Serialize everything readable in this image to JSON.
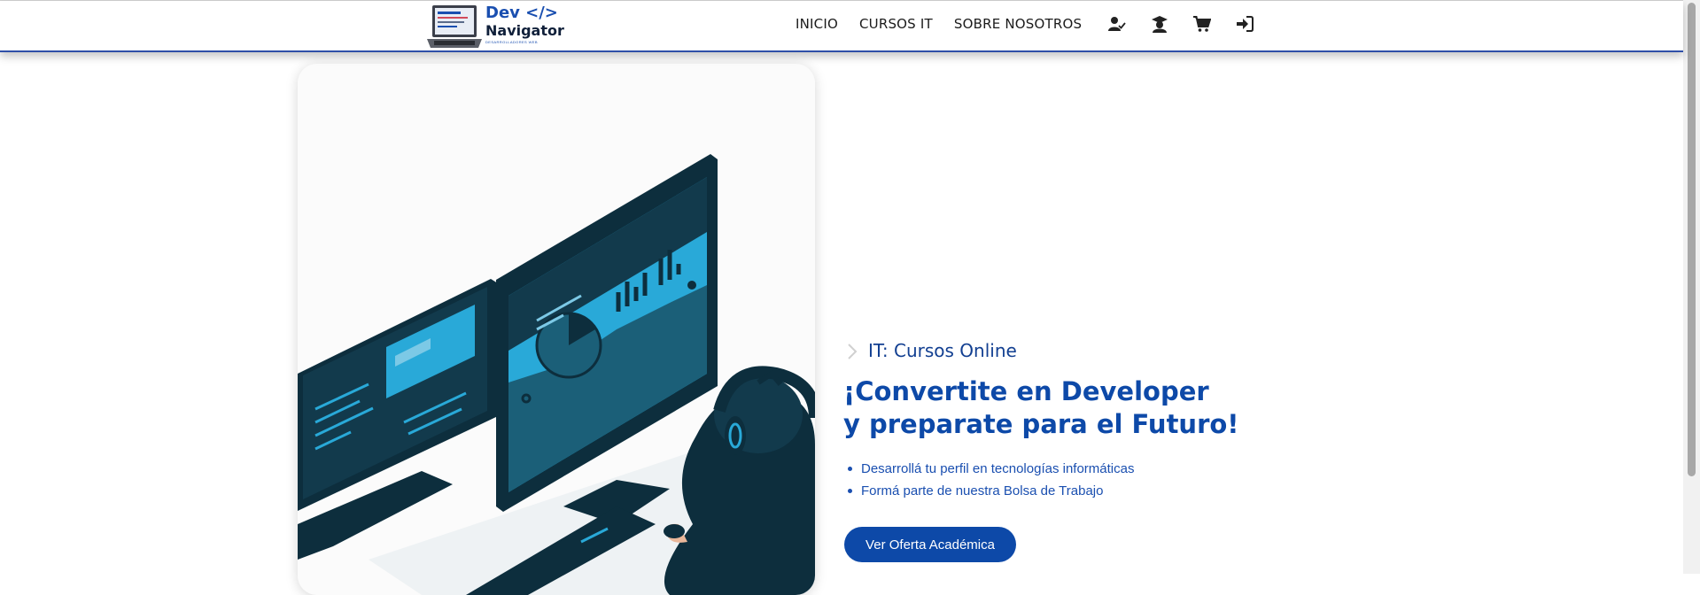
{
  "brand": {
    "name_line1": "Dev </>",
    "name_line2": "Navigator",
    "tagline": "DESARROLLADORES WEB"
  },
  "nav": {
    "links": [
      "INICIO",
      "CURSOS IT",
      "SOBRE NOSOTROS"
    ],
    "icons": [
      "user-check-icon",
      "graduation-cap-icon",
      "cart-icon",
      "sign-in-icon"
    ]
  },
  "hero": {
    "subtitle": "IT: Cursos Online",
    "title_line1": "¡Convertite en Developer",
    "title_line2": "y preparate para el Futuro!",
    "bullets": [
      "Desarrollá tu perfil en tecnologías informáticas",
      "Formá parte de nuestra Bolsa de Trabajo"
    ],
    "cta_label": "Ver Oferta Académica"
  },
  "colors": {
    "accent": "#0d49a8",
    "subtitle": "#123f91",
    "nav_border": "#2f4fa8",
    "illustration_dark": "#0d2e3d",
    "illustration_cyan": "#29a9d8"
  }
}
